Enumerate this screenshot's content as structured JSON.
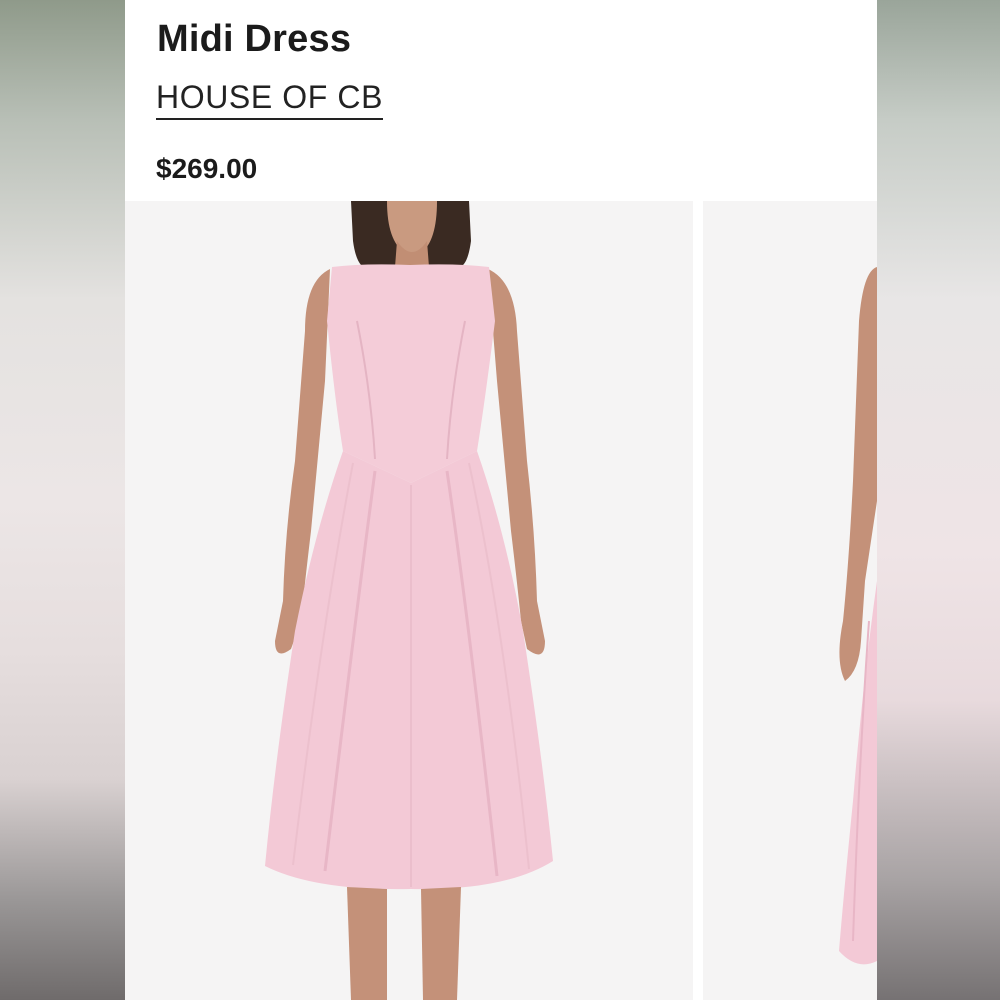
{
  "product": {
    "title": "Midi Dress",
    "brand": "HOUSE OF CB",
    "price": "$269.00"
  },
  "gallery": {
    "images": [
      {
        "name": "main-product-photo",
        "alt": "Pink sleeveless midi dress, front view"
      },
      {
        "name": "next-product-photo",
        "alt": "Pink midi dress, side view"
      }
    ]
  },
  "colors": {
    "dress": "#f3c9d6",
    "background": "#f5f4f4",
    "text": "#1b1b1b"
  }
}
